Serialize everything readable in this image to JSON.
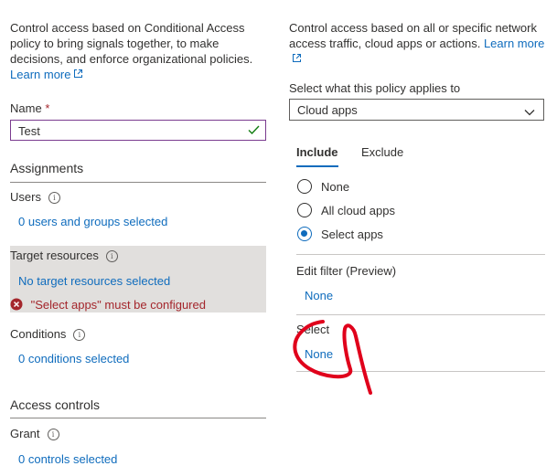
{
  "left": {
    "intro": "Control access based on Conditional Access policy to bring signals together, to make decisions, and enforce organizational policies.",
    "learn_more": "Learn more",
    "name_label": "Name",
    "required_mark": "*",
    "name_value": "Test",
    "assignments_heading": "Assignments",
    "users_label": "Users",
    "users_value": "0 users and groups selected",
    "target_label": "Target resources",
    "target_value": "No target resources selected",
    "target_error": "\"Select apps\" must be configured",
    "conditions_label": "Conditions",
    "conditions_value": "0 conditions selected",
    "access_controls_heading": "Access controls",
    "grant_label": "Grant",
    "grant_value": "0 controls selected"
  },
  "right": {
    "intro": "Control access based on all or specific network access traffic, cloud apps or actions.",
    "learn_more": "Learn more",
    "applies_label": "Select what this policy applies to",
    "applies_value": "Cloud apps",
    "tabs": [
      {
        "label": "Include",
        "active": true
      },
      {
        "label": "Exclude",
        "active": false
      }
    ],
    "options": [
      {
        "label": "None",
        "checked": false
      },
      {
        "label": "All cloud apps",
        "checked": false
      },
      {
        "label": "Select apps",
        "checked": true
      }
    ],
    "edit_filter_label": "Edit filter (Preview)",
    "edit_filter_value": "None",
    "select_label": "Select",
    "select_value": "None"
  },
  "colors": {
    "link": "#0f6cbd",
    "error": "#a4262c",
    "highlight": "#e1dfdd",
    "annotation": "#e0001b"
  },
  "icons": [
    "external-link-icon",
    "check-icon",
    "info-icon",
    "error-icon",
    "chevron-down-icon"
  ]
}
